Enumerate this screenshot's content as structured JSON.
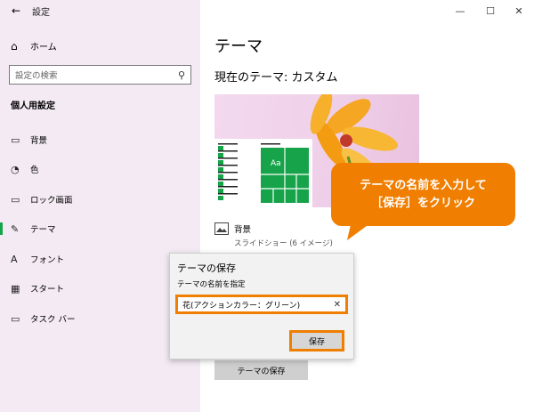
{
  "window": {
    "title": "設定",
    "back_icon": "←",
    "minimize_icon": "—",
    "maximize_icon": "☐",
    "close_icon": "✕"
  },
  "sidebar": {
    "home_icon": "⌂",
    "home_label": "ホーム",
    "search_placeholder": "設定の検索",
    "search_icon": "⚲",
    "section_title": "個人用設定",
    "items": [
      {
        "label": "背景",
        "icon": "▭"
      },
      {
        "label": "色",
        "icon": "◔"
      },
      {
        "label": "ロック画面",
        "icon": "▭"
      },
      {
        "label": "テーマ",
        "icon": "✎"
      },
      {
        "label": "フォント",
        "icon": "A"
      },
      {
        "label": "スタート",
        "icon": "▦"
      },
      {
        "label": "タスク バー",
        "icon": "▭"
      }
    ]
  },
  "main": {
    "heading": "テーマ",
    "current_theme": "現在のテーマ: カスタム",
    "preview_tile_text": "Aa",
    "background_label": "背景",
    "background_value": "スライドショー (6 イメージ)",
    "save_theme_button": "テーマの保存"
  },
  "callout": {
    "line1": "テーマの名前を入力して",
    "line2": "［保存］をクリック"
  },
  "dialog": {
    "title": "テーマの保存",
    "subtitle": "テーマの名前を指定",
    "input_value": "花(アクションカラー：グリーン)",
    "clear_icon": "✕",
    "save_button": "保存"
  },
  "colors": {
    "accent_green": "#16a34a",
    "highlight_orange": "#f07e00",
    "sidebar_bg": "#f3eaf3"
  }
}
